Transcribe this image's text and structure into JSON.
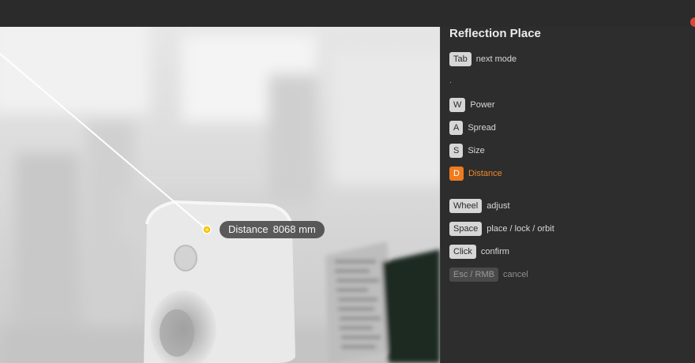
{
  "panel": {
    "title": "Reflection Place",
    "sep": ".",
    "rows": [
      {
        "key": "Tab",
        "label": "next mode"
      },
      {
        "key": "W",
        "label": "Power"
      },
      {
        "key": "A",
        "label": "Spread"
      },
      {
        "key": "S",
        "label": "Size"
      },
      {
        "key": "D",
        "label": "Distance",
        "state": "active"
      },
      {
        "key": "Wheel",
        "label": "adjust"
      },
      {
        "key": "Space",
        "label": "place / lock / orbit"
      },
      {
        "key": "Click",
        "label": "confirm"
      },
      {
        "key": "Esc / RMB",
        "label": "cancel",
        "state": "muted"
      }
    ]
  },
  "viewport": {
    "distance_label": "Distance",
    "distance_value": "8068 mm"
  },
  "colors": {
    "accent": "#f07a1f",
    "active_text": "#f2872d",
    "target_dot": "#f2c200",
    "close_dot": "#d9473a"
  },
  "icons": [
    "target-dot-icon",
    "close-dot-icon"
  ]
}
